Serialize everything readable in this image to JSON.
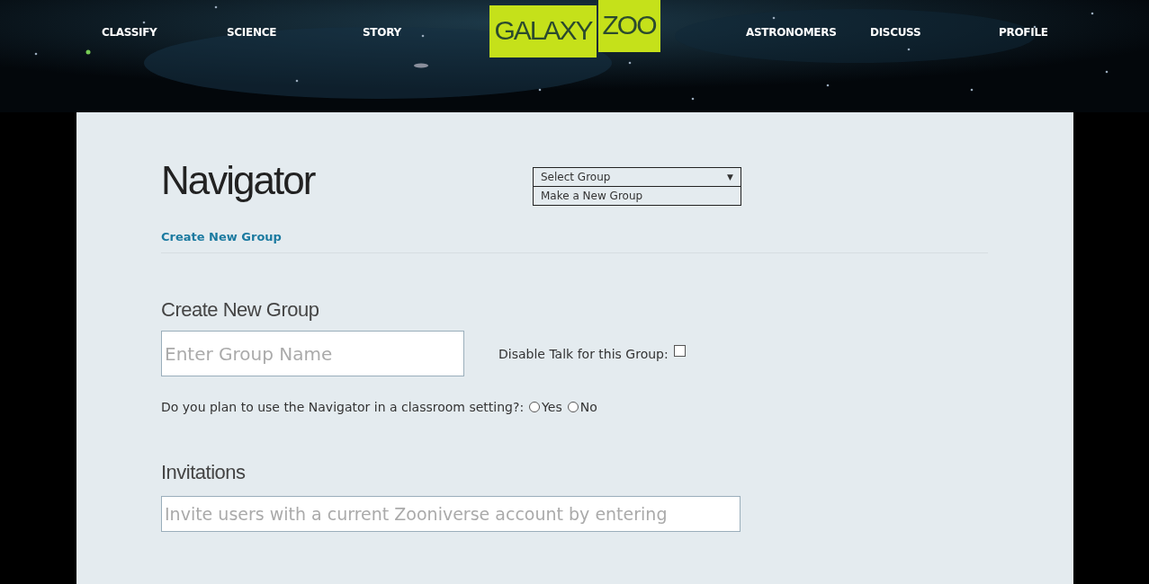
{
  "nav": {
    "left": [
      {
        "label": "CLASSIFY"
      },
      {
        "label": "SCIENCE"
      },
      {
        "label": "STORY"
      }
    ],
    "logo": [
      "GALAXY",
      "ZOO"
    ],
    "right": [
      {
        "label": "ASTRONOMERS"
      },
      {
        "label": "DISCUSS"
      },
      {
        "label": "PROFILE"
      }
    ]
  },
  "title": "Navigator",
  "group_select": {
    "value": "Select Group",
    "caret": "▼",
    "options": [
      {
        "label": "Make a New Group"
      }
    ]
  },
  "link": "Create New Group",
  "form": {
    "heading": "Create New Group",
    "name_field": {
      "placeholder": "Enter Group Name"
    },
    "disable_talk": {
      "label": "Disable Talk for this Group:",
      "checked": false
    },
    "classroom": {
      "question": "Do you plan to use the Navigator in a classroom setting?:",
      "options": [
        {
          "label": "Yes",
          "selected": false
        },
        {
          "label": "No",
          "selected": false
        }
      ]
    },
    "invitations_heading": "Invitations",
    "invite_field": {
      "placeholder": "Invite users with a current Zooniverse account by entering"
    }
  }
}
